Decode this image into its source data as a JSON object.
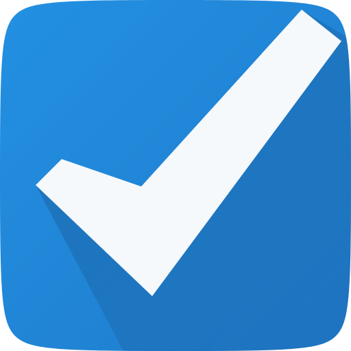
{
  "icon": {
    "name": "checkmark-app-icon",
    "glyph": "check-icon",
    "colors": {
      "background_top": "#2390E2",
      "background_bottom": "#1F7BCB",
      "shadow": "#1A5E9E",
      "checkmark": "#F5F9FC"
    }
  }
}
